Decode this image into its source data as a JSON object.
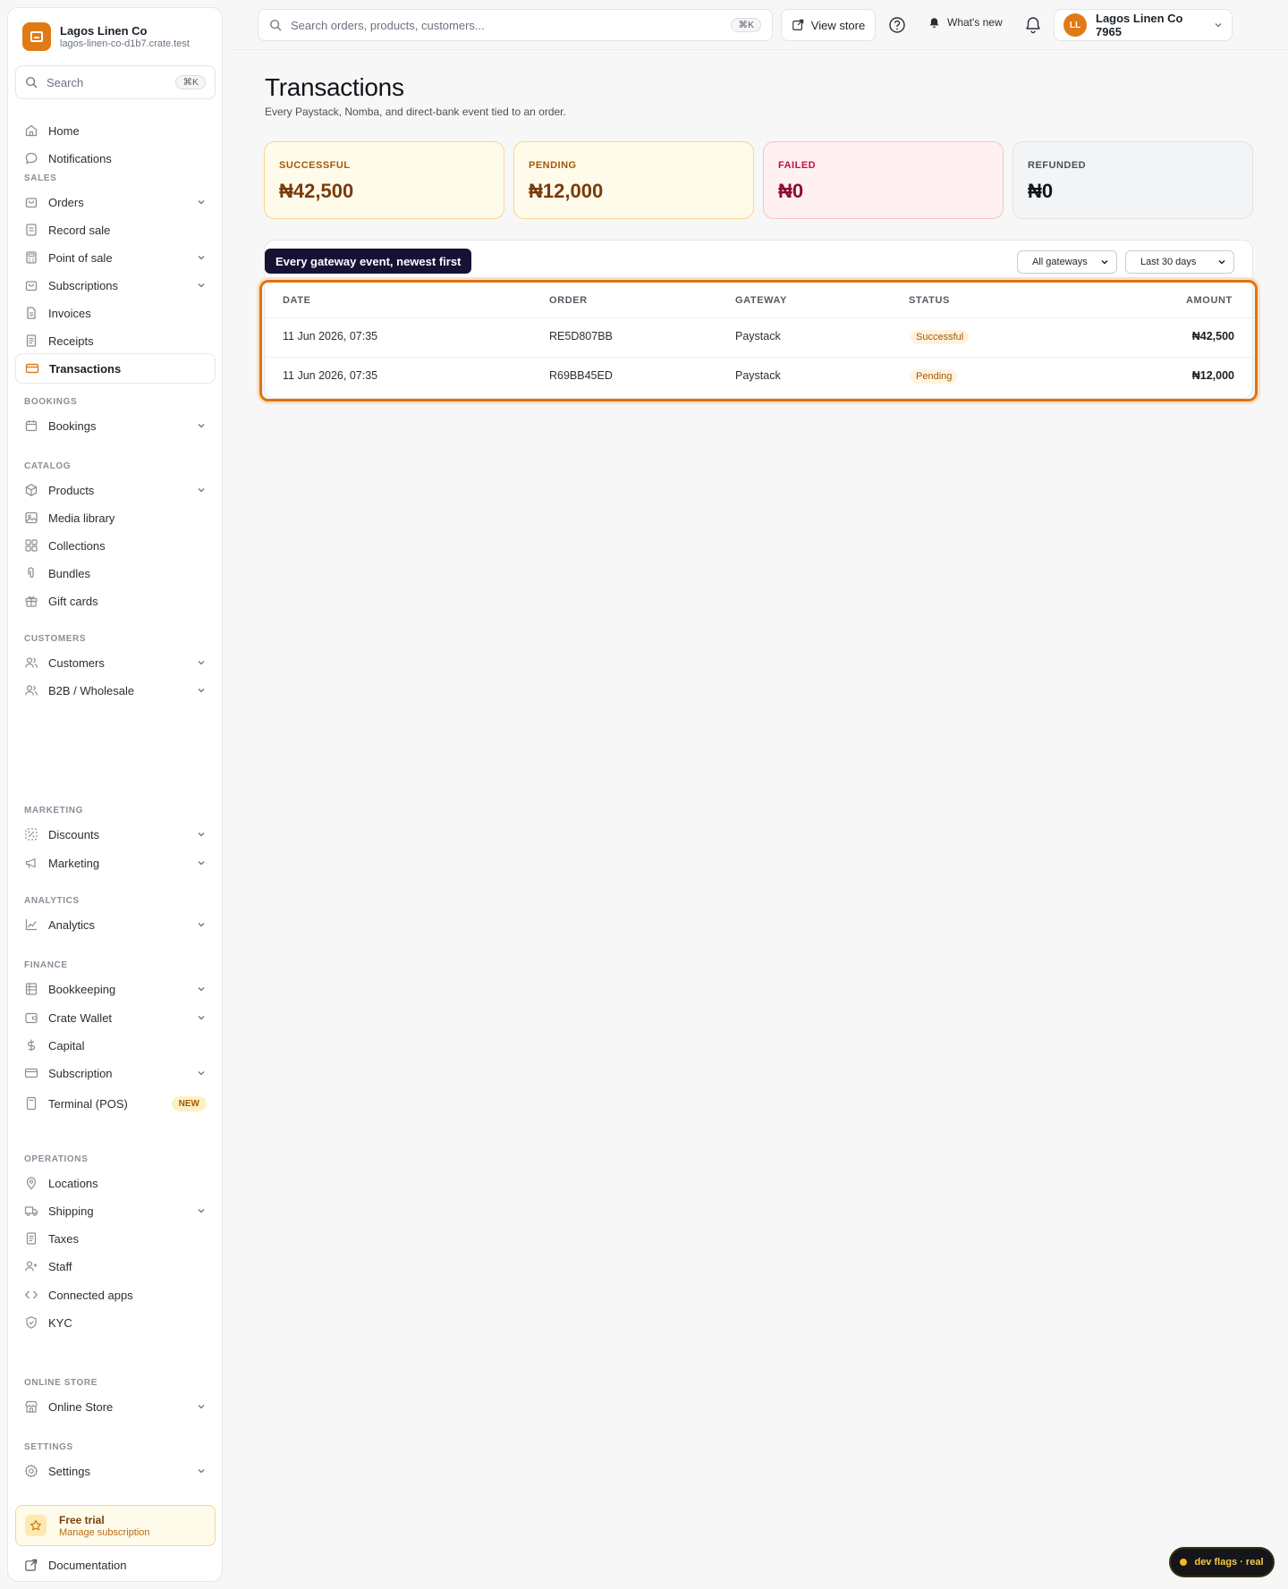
{
  "brand": {
    "name": "Lagos Linen Co",
    "domain": "lagos-linen-co-d1b7.crate.test"
  },
  "sidebar": {
    "search": {
      "label": "Search",
      "shortcut": "⌘K"
    },
    "sections": {
      "sales": "SALES",
      "bookings": "BOOKINGS",
      "catalog": "CATALOG",
      "customers": "CUSTOMERS",
      "marketing": "MARKETING",
      "analytics": "ANALYTICS",
      "finance": "FINANCE",
      "operations": "OPERATIONS",
      "online_store": "ONLINE STORE",
      "settings": "SETTINGS"
    },
    "items": {
      "home": "Home",
      "notifications": "Notifications",
      "orders": "Orders",
      "record_sale": "Record sale",
      "point_of_sale": "Point of sale",
      "subscriptions": "Subscriptions",
      "invoices": "Invoices",
      "receipts": "Receipts",
      "transactions": "Transactions",
      "bookings": "Bookings",
      "products": "Products",
      "media_library": "Media library",
      "collections": "Collections",
      "bundles": "Bundles",
      "gift_cards": "Gift cards",
      "customers": "Customers",
      "b2b": "B2B / Wholesale",
      "discounts": "Discounts",
      "marketing": "Marketing",
      "analytics": "Analytics",
      "bookkeeping": "Bookkeeping",
      "crate_wallet": "Crate Wallet",
      "capital": "Capital",
      "subscription": "Subscription",
      "terminal": "Terminal (POS)",
      "terminal_badge": "NEW",
      "locations": "Locations",
      "shipping": "Shipping",
      "taxes": "Taxes",
      "staff": "Staff",
      "connected_apps": "Connected apps",
      "kyc": "KYC",
      "online_store": "Online Store",
      "settings": "Settings"
    },
    "trial": {
      "title": "Free trial",
      "subtitle": "Manage subscription"
    },
    "documentation": "Documentation"
  },
  "topbar": {
    "search_placeholder": "Search orders, products, customers...",
    "search_shortcut": "⌘K",
    "view_store": "View store",
    "whats_new": "What's new",
    "account_name": "Lagos Linen Co 7965",
    "account_initials": "LL"
  },
  "page": {
    "title": "Transactions",
    "subtitle": "Every Paystack, Nomba, and direct-bank event tied to an order."
  },
  "stats": {
    "successful": {
      "label": "SUCCESSFUL",
      "value": "₦42,500"
    },
    "pending": {
      "label": "PENDING",
      "value": "₦12,000"
    },
    "failed": {
      "label": "FAILED",
      "value": "₦0"
    },
    "refunded": {
      "label": "REFUNDED",
      "value": "₦0"
    }
  },
  "table": {
    "tooltip": "Every gateway event, newest first",
    "filters": {
      "gateway": "All gateways",
      "period": "Last 30 days"
    },
    "columns": {
      "date": "DATE",
      "order": "ORDER",
      "gateway": "GATEWAY",
      "status": "STATUS",
      "amount": "AMOUNT"
    },
    "rows": [
      {
        "date": "11 Jun 2026, 07:35",
        "order": "RE5D807BB",
        "gateway": "Paystack",
        "status": "Successful",
        "amount": "₦42,500"
      },
      {
        "date": "11 Jun 2026, 07:35",
        "order": "R69BB45ED",
        "gateway": "Paystack",
        "status": "Pending",
        "amount": "₦12,000"
      }
    ]
  },
  "dev_flags": "dev flags · real",
  "colors": {
    "accent": "#e07a16",
    "tooltip_bg": "#161236"
  }
}
